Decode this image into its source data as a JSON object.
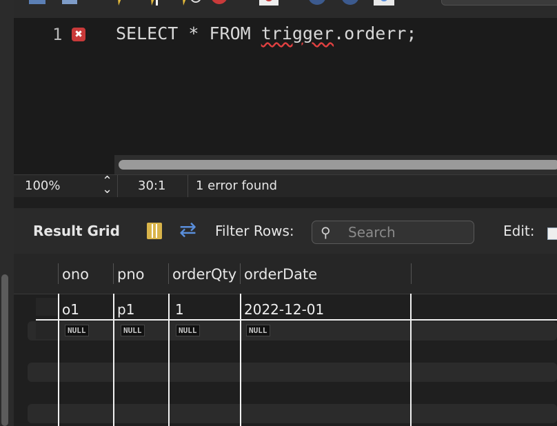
{
  "editor": {
    "line_number": "1",
    "code_keyword": "SELECT * FROM ",
    "code_underlined": "trigger",
    "code_rest": ".orderr;"
  },
  "status": {
    "zoom": "100%",
    "cursor_position": "30:1",
    "error_count": "1 error found"
  },
  "result_toolbar": {
    "result_grid_label": "Result Grid",
    "filter_label": "Filter Rows:",
    "search_placeholder": "Search",
    "edit_label": "Edit:"
  },
  "grid": {
    "columns": [
      "ono",
      "pno",
      "orderQty",
      "orderDate"
    ],
    "rows": [
      [
        "o1",
        "p1",
        "1",
        "2022-12-01"
      ],
      [
        "NULL",
        "NULL",
        "NULL",
        "NULL"
      ]
    ]
  },
  "colors": {
    "error_red": "#c93a3a",
    "accent_blue": "#5a8fdc",
    "grid_icon_yellow": "#d9b44a"
  }
}
